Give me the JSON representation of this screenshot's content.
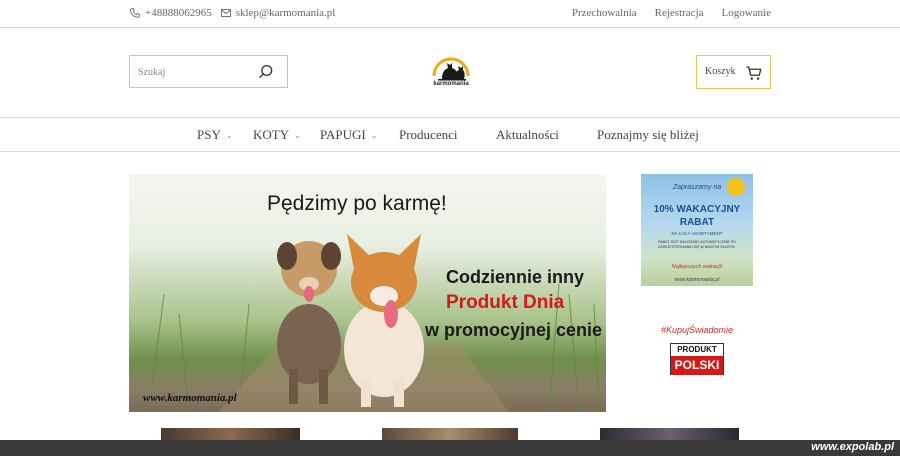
{
  "topbar": {
    "phone": "+48888062965",
    "email": "sklep@karmomania.pl",
    "links": [
      "Przechowalnia",
      "Rejestracja",
      "Logowanie"
    ]
  },
  "search": {
    "placeholder": "Szukaj"
  },
  "logo": {
    "text": "karmomania"
  },
  "cart": {
    "label": "Koszyk"
  },
  "nav": {
    "items": [
      {
        "label": "PSY",
        "has_dropdown": true
      },
      {
        "label": "KOTY",
        "has_dropdown": true
      },
      {
        "label": "PAPUGI",
        "has_dropdown": true
      },
      {
        "label": "Producenci",
        "has_dropdown": false
      },
      {
        "label": "Aktualności",
        "has_dropdown": false
      },
      {
        "label": "Poznajmy się bliżej",
        "has_dropdown": false
      }
    ]
  },
  "hero": {
    "headline": "Pędzimy po karmę!",
    "line1": "Codziennie inny",
    "line2": "Produkt Dnia",
    "line3": "w promocyjnej cenie",
    "url": "www.karmomania.pl"
  },
  "promo": {
    "line1": "Zapraszamy na",
    "line2": "10% WAKACYJNY",
    "line3": "RABAT",
    "line4": "NA CAŁY ASORTYMENT",
    "line5": "RABAT JEST NALICZANY AUTOMATYCZNIE PO ZAREJESTROWANIU SIĘ W NASZYM SKLEPIE.",
    "line6": "Najlepszych wakacji!",
    "line7": "www.karmomania.pl"
  },
  "hashtag": "#KupujŚwiadomie",
  "badge": {
    "top": "PRODUKT",
    "bottom": "POLSKI"
  },
  "watermark": "www.expolab.pl",
  "colors": {
    "accent": "#f0c060",
    "red": "#d11a1a"
  }
}
